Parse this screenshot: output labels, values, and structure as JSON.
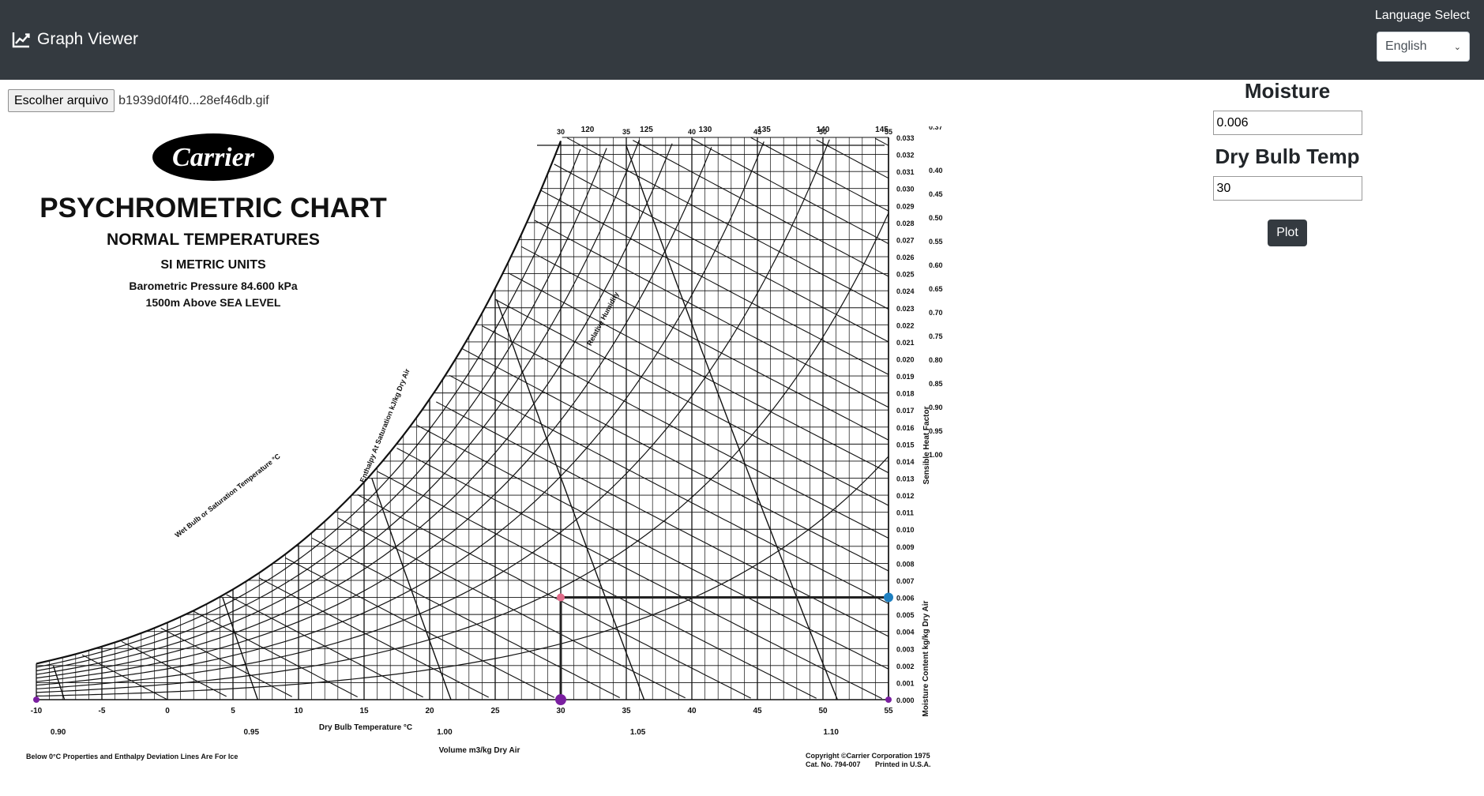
{
  "navbar": {
    "brand_title": "Graph Viewer",
    "brand_icon": "line-chart-icon",
    "language_label": "Language Select",
    "language_selected": "English"
  },
  "file": {
    "button_label": "Escolher arquivo",
    "file_name": "b1939d0f4f0...28ef46db.gif"
  },
  "chart": {
    "logo": "Carrier",
    "title": "PSYCHROMETRIC CHART",
    "subtitle": "NORMAL TEMPERATURES",
    "units": "SI METRIC UNITS",
    "pressure": "Barometric Pressure 84.600 kPa",
    "altitude": "1500m Above SEA LEVEL",
    "x_axis_label": "Dry Bulb Temperature °C",
    "x_ticks": [
      "-10",
      "-5",
      "0",
      "5",
      "10",
      "15",
      "20",
      "25",
      "30",
      "35",
      "40",
      "45",
      "50",
      "55"
    ],
    "volume_label": "Volume m3/kg Dry Air",
    "volume_ticks": [
      "0.90",
      "0.95",
      "1.00",
      "1.05",
      "1.10"
    ],
    "moisture_axis_label": "Moisture Content kg/kg Dry Air",
    "moisture_ticks": [
      "0.000",
      "0.001",
      "0.002",
      "0.003",
      "0.004",
      "0.005",
      "0.006",
      "0.007",
      "0.008",
      "0.009",
      "0.010",
      "0.011",
      "0.012",
      "0.013",
      "0.014",
      "0.015",
      "0.016",
      "0.017",
      "0.018",
      "0.019",
      "0.020",
      "0.021",
      "0.022",
      "0.023",
      "0.024",
      "0.025",
      "0.026",
      "0.027",
      "0.028",
      "0.029",
      "0.030",
      "0.031",
      "0.032",
      "0.033"
    ],
    "top_enthalpy_ticks": [
      "120",
      "125",
      "130",
      "135",
      "140",
      "145"
    ],
    "top_db_ticks": [
      "30",
      "35",
      "40",
      "45",
      "50",
      "55"
    ],
    "shf_label": "Sensible Heat Factor",
    "shf_ticks": [
      "0.37",
      "0.40",
      "0.45",
      "0.50",
      "0.55",
      "0.60",
      "0.65",
      "0.70",
      "0.75",
      "0.80",
      "0.85",
      "0.90",
      "0.95",
      "1.00"
    ],
    "enthalpy_label": "Enthalpy At Saturation kJ/kg Dry Air",
    "wet_bulb_label": "Wet Bulb or Saturation Temperature °C",
    "rh_label": "Relative Humidity",
    "footnote_left": "Below 0°C Properties and Enthalpy Deviation Lines Are For Ice",
    "copyright": "Copyright ©Carrier Corporation 1975",
    "catalog": "Cat. No. 794-007",
    "printed": "Printed in U.S.A.",
    "marker_colors": {
      "state_point": "#e06c8a",
      "moisture_point": "#1e7fc0",
      "temp_point": "#7a1fa0"
    }
  },
  "chart_data": {
    "type": "scatter",
    "title": "PSYCHROMETRIC CHART",
    "xlabel": "Dry Bulb Temperature °C",
    "ylabel": "Moisture Content kg/kg Dry Air",
    "xlim": [
      -10,
      55
    ],
    "ylim": [
      0,
      0.033
    ],
    "points": [
      {
        "x": 30,
        "y": 0.006
      },
      {
        "x": 55,
        "y": 0.006
      },
      {
        "x": 30,
        "y": 0
      },
      {
        "x": -10,
        "y": 0
      },
      {
        "x": 55,
        "y": 0
      }
    ]
  },
  "form": {
    "moisture_label": "Moisture",
    "moisture_value": "0.006",
    "temp_label": "Dry Bulb Temp",
    "temp_value": "30",
    "plot_label": "Plot"
  }
}
